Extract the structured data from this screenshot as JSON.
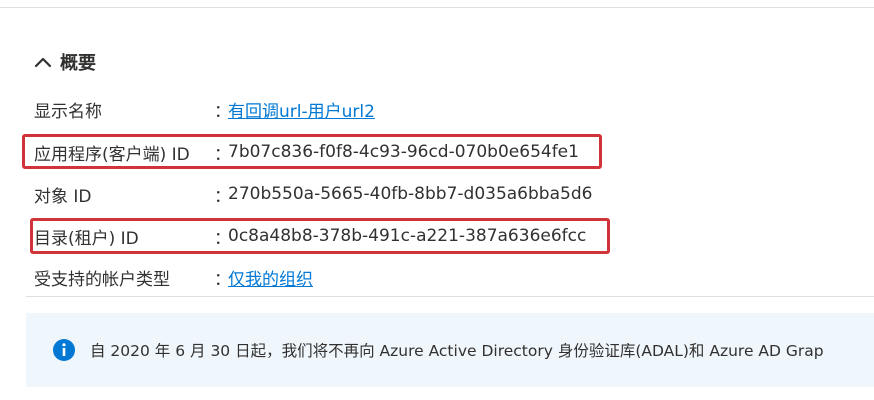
{
  "overview": {
    "title": "概要"
  },
  "properties": [
    {
      "label": "显示名称",
      "colon": "：",
      "value": "有回调url-用户url2"
    },
    {
      "label": "应用程序(客户端) ID",
      "colon": "：",
      "value": "7b07c836-f0f8-4c93-96cd-070b0e654fe1"
    },
    {
      "label": "对象 ID",
      "colon": "：",
      "value": "270b550a-5665-40fb-8bb7-d035a6bba5d6"
    },
    {
      "label": "目录(租户) ID",
      "colon": "：",
      "value": "0c8a48b8-378b-491c-a221-387a636e6fcc"
    },
    {
      "label": "受支持的帐户类型",
      "colon": "：",
      "value": "仅我的组织"
    }
  ],
  "banner": {
    "text": "自 2020 年 6 月 30 日起，我们将不再向 Azure Active Directory 身份验证库(ADAL)和 Azure AD Grap"
  },
  "colors": {
    "link": "#0078d4",
    "highlight": "#d13438",
    "banner_bg": "#eff6fc",
    "info_icon": "#0078d4"
  },
  "icons": {
    "collapse": "chevron-up-icon",
    "info": "info-icon"
  }
}
